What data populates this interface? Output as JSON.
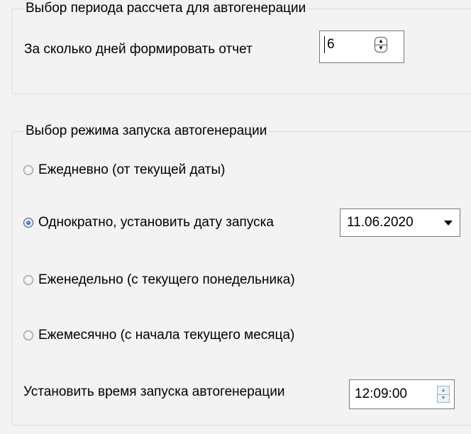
{
  "period_group": {
    "title": "Выбор периода рассчета для автогенерации",
    "days_label": "За сколько дней формировать отчет",
    "days_value": "6",
    "spin_up_icon": "triangle-up",
    "spin_down_icon": "triangle-down"
  },
  "mode_group": {
    "title": "Выбор режима запуска автогенерации",
    "options": [
      {
        "label": "Ежедневно (от текущей даты)",
        "checked": false
      },
      {
        "label": "Однократно, установить дату запуска",
        "checked": true
      },
      {
        "label": "Еженедельно (с текущего понедельника)",
        "checked": false
      },
      {
        "label": "Ежемесячно (с начала текущего месяца)",
        "checked": false
      }
    ],
    "start_date": "11.06.2020",
    "time_label": "Установить время запуска автогенерации",
    "time_value": "12:09:00"
  },
  "colors": {
    "background": "#f3f3f3",
    "group_border": "#d5dfe5",
    "radio_checked": "#2468c4"
  }
}
